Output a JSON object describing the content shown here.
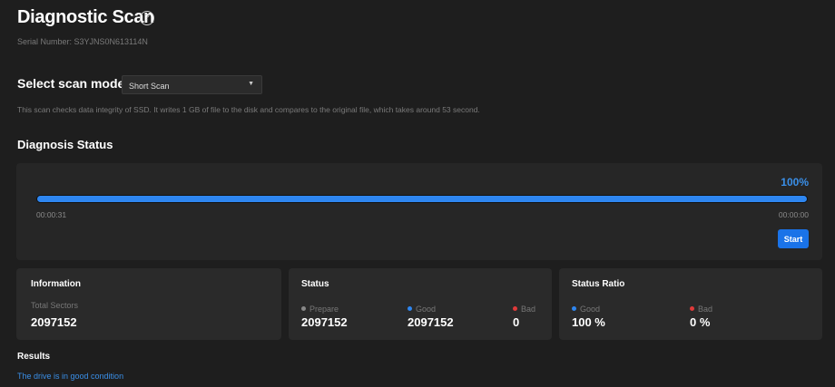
{
  "header": {
    "title": "Diagnostic Scan",
    "help_icon": "?",
    "serial": "Serial Number: S3YJNS0N613114N"
  },
  "scan_mode": {
    "label": "Select scan mode",
    "selected": "Short Scan",
    "description": "This scan checks data integrity of SSD. It writes 1 GB of file to the disk and compares to the original file, which takes around 53 second."
  },
  "diagnosis": {
    "title": "Diagnosis Status",
    "percent_label": "100%",
    "progress": 100,
    "elapsed": "00:00:31",
    "remaining": "00:00:00",
    "start_label": "Start"
  },
  "information": {
    "title": "Information",
    "total_label": "Total Sectors",
    "total_value": "2097152"
  },
  "status": {
    "title": "Status",
    "prepare_label": "Prepare",
    "prepare_value": "2097152",
    "good_label": "Good",
    "good_value": "2097152",
    "bad_label": "Bad",
    "bad_value": "0"
  },
  "ratio": {
    "title": "Status Ratio",
    "good_label": "Good",
    "good_value": "100 %",
    "bad_label": "Bad",
    "bad_value": "0 %"
  },
  "results": {
    "title": "Results",
    "message": "The drive is in good condition"
  },
  "colors": {
    "accent": "#2e86f0",
    "good": "#2e86f0",
    "bad": "#e03a3a",
    "prepare": "#888888"
  }
}
